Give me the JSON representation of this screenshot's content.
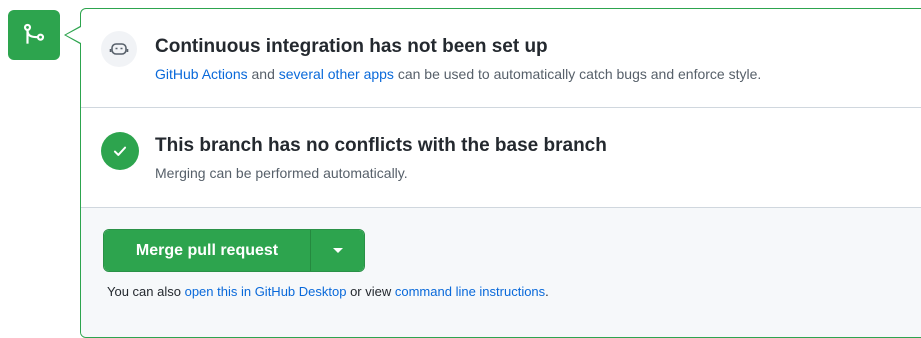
{
  "ci": {
    "heading": "Continuous integration has not been set up",
    "link_actions": "GitHub Actions",
    "text_and": " and ",
    "link_other_apps": "several other apps",
    "text_rest": " can be used to automatically catch bugs and enforce style."
  },
  "conflicts": {
    "heading": "This branch has no conflicts with the base branch",
    "sub": "Merging can be performed automatically."
  },
  "merge": {
    "button_label": "Merge pull request",
    "also_prefix": "You can also ",
    "link_desktop": "open this in GitHub Desktop",
    "also_middle": " or view ",
    "link_cli": "command line instructions",
    "also_suffix": "."
  },
  "icons": {
    "badge": "git-merge-icon",
    "ci": "ci-robot-icon",
    "check": "check-icon",
    "caret": "caret-down-icon"
  },
  "colors": {
    "green": "#2da44e",
    "link": "#0969da",
    "muted": "#57606a"
  }
}
